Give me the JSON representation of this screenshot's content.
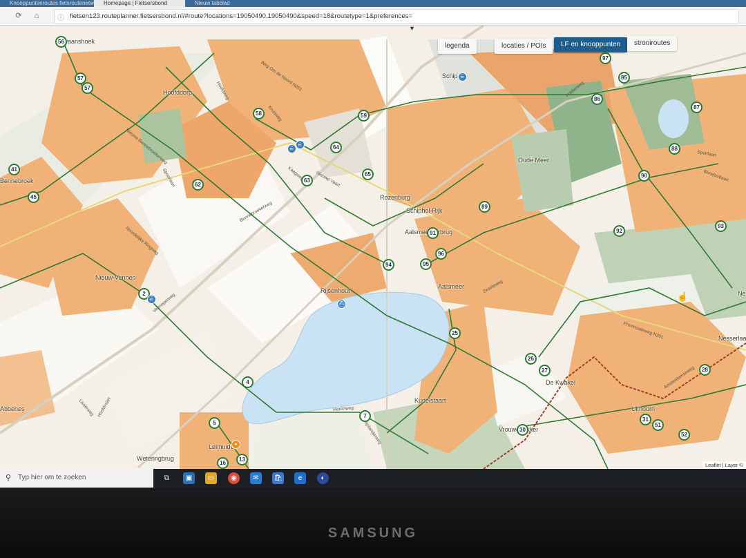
{
  "browser": {
    "tabs": [
      {
        "label": "Knooppuntenroutes fietsroutenetw"
      },
      {
        "label": "Homepage | Fietsersbond"
      },
      {
        "label": "Nieuw tabblad"
      }
    ],
    "url": "fietsen123.routeplanner.fietsersbond.nl/#route?locations=19050490,19050490&speed=18&routetype=1&preferences="
  },
  "map": {
    "buttons": [
      {
        "label": "legenda",
        "active": false
      },
      {
        "label": "locaties / POIs",
        "active": false
      },
      {
        "label": "LF en knooppunten",
        "active": true
      },
      {
        "label": "strooiroutes",
        "active": false
      }
    ],
    "places": [
      "Zwaanshoek",
      "Hoofddorp",
      "Schip",
      "Oude Meer",
      "Rozenburg",
      "Schiphol-Rijk",
      "Aalsmeerderbrug",
      "Nieuw-Vennep",
      "Rijsenhout",
      "Aalsmeer",
      "De Kwakel",
      "Kudelstaart",
      "Uithoorn",
      "Leimuiden",
      "Weteringbrug",
      "Vrouwenakker",
      "Bennebroek",
      "Abbenes",
      "Nes",
      "Nesserlaan"
    ],
    "streets": [
      "Weg Om de Noord N201",
      "Kruisweg",
      "Hoofdweg",
      "Nieuwe Bennebroekerweg",
      "Spoorlaan",
      "Kaagweg",
      "Nieuwe Vaart",
      "Bennebroekerweg",
      "Noordelijke Ringweg",
      "Venneperweg",
      "Fokkerweg",
      "Zwarteweg",
      "Provincialeweg N201",
      "Amsterdamseweg",
      "Herenweg",
      "Rijnlanderweg",
      "Lisserweg",
      "Hoofdvaart",
      "Sportlaan",
      "Beneluxbaan"
    ],
    "nodes": [
      "56",
      "57",
      "57",
      "58",
      "59",
      "64",
      "65",
      "63",
      "62",
      "45",
      "41",
      "97",
      "85",
      "86",
      "87",
      "88",
      "90",
      "89",
      "91",
      "92",
      "93",
      "96",
      "95",
      "94",
      "2",
      "25",
      "26",
      "27",
      "28",
      "4",
      "5",
      "7",
      "16",
      "13",
      "30",
      "31",
      "51",
      "52"
    ],
    "attribution": "Leaflet | Layer ©"
  },
  "taskbar": {
    "search_placeholder": "Typ hier om te zoeken",
    "apps": [
      "task-view",
      "photos",
      "file-explorer",
      "chrome",
      "mail",
      "store",
      "edge",
      "firefox"
    ]
  },
  "monitor": {
    "brand": "SAMSUNG"
  },
  "colors": {
    "urban": "#f1b277",
    "water": "#c9e3f5",
    "grass": "#a9c49f",
    "route": "#2e7a34",
    "active_button": "#1d5e8e"
  }
}
